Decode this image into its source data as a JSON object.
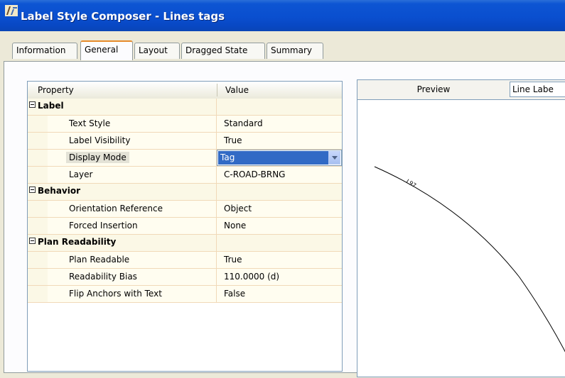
{
  "window": {
    "title": "Label Style Composer - Lines tags"
  },
  "tabs": [
    {
      "label": "Information"
    },
    {
      "label": "General"
    },
    {
      "label": "Layout"
    },
    {
      "label": "Dragged State"
    },
    {
      "label": "Summary"
    }
  ],
  "active_tab": "General",
  "grid": {
    "col_property": "Property",
    "col_value": "Value",
    "categories": [
      {
        "label": "Label",
        "rows": [
          {
            "name": "Text Style",
            "value": "Standard"
          },
          {
            "name": "Label Visibility",
            "value": "True"
          },
          {
            "name": "Display Mode",
            "value": "Tag"
          },
          {
            "name": "Layer",
            "value": "C-ROAD-BRNG"
          }
        ]
      },
      {
        "label": "Behavior",
        "rows": [
          {
            "name": "Orientation Reference",
            "value": "Object"
          },
          {
            "name": "Forced Insertion",
            "value": "None"
          }
        ]
      },
      {
        "label": "Plan Readability",
        "rows": [
          {
            "name": "Plan Readable",
            "value": "True"
          },
          {
            "name": "Readability Bias",
            "value": "110.0000 (d)"
          },
          {
            "name": "Flip Anchors with Text",
            "value": "False"
          }
        ]
      }
    ]
  },
  "preview": {
    "title": "Preview",
    "selector_value": "Line Labe",
    "tag_label": "L97"
  },
  "colors": {
    "titlebar": "#0a4fcf",
    "selection": "#316ac5",
    "active_tab_accent": "#e68b2c"
  }
}
